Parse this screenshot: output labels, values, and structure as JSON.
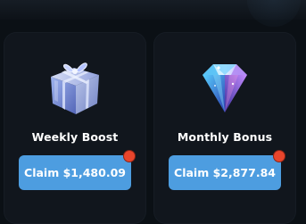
{
  "rewards": [
    {
      "title": "Weekly Boost",
      "claim_label": "Claim $1,480.09",
      "icon": "gift-box-icon"
    },
    {
      "title": "Monthly Bonus",
      "claim_label": "Claim $2,877.84",
      "icon": "diamond-icon"
    }
  ],
  "colors": {
    "background": "#0b1015",
    "card": "#11161d",
    "button": "#4d9de0",
    "notification": "#e8452c",
    "text": "#ffffff"
  }
}
